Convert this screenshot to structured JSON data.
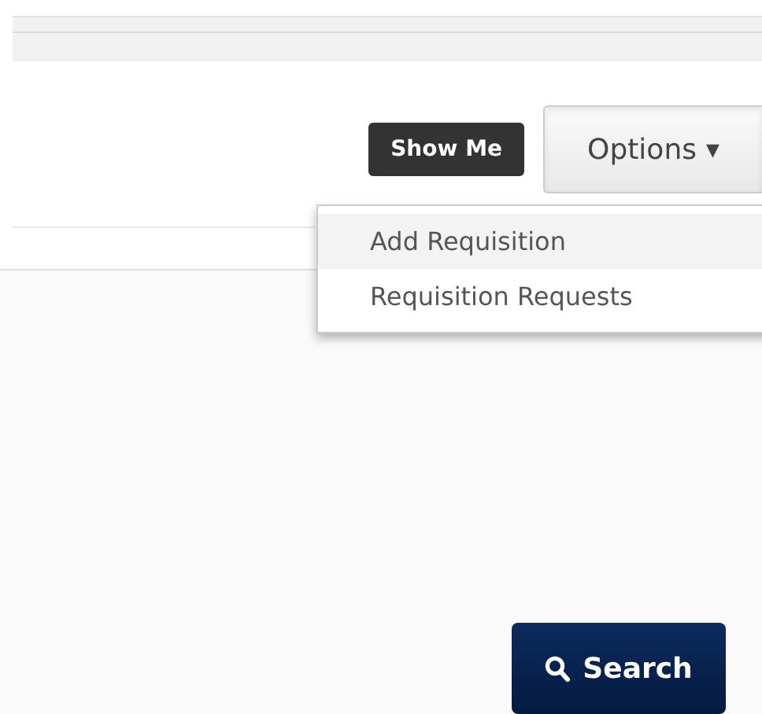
{
  "toolbar": {
    "show_me_button": "Show Me",
    "options_button": {
      "label": "Options",
      "caret": "▼",
      "expanded": true
    }
  },
  "options_menu": [
    {
      "label": "Add Requisition",
      "selected": true
    },
    {
      "label": "Requisition Requests",
      "selected": false
    }
  ],
  "search_button": {
    "label": "Search"
  }
}
